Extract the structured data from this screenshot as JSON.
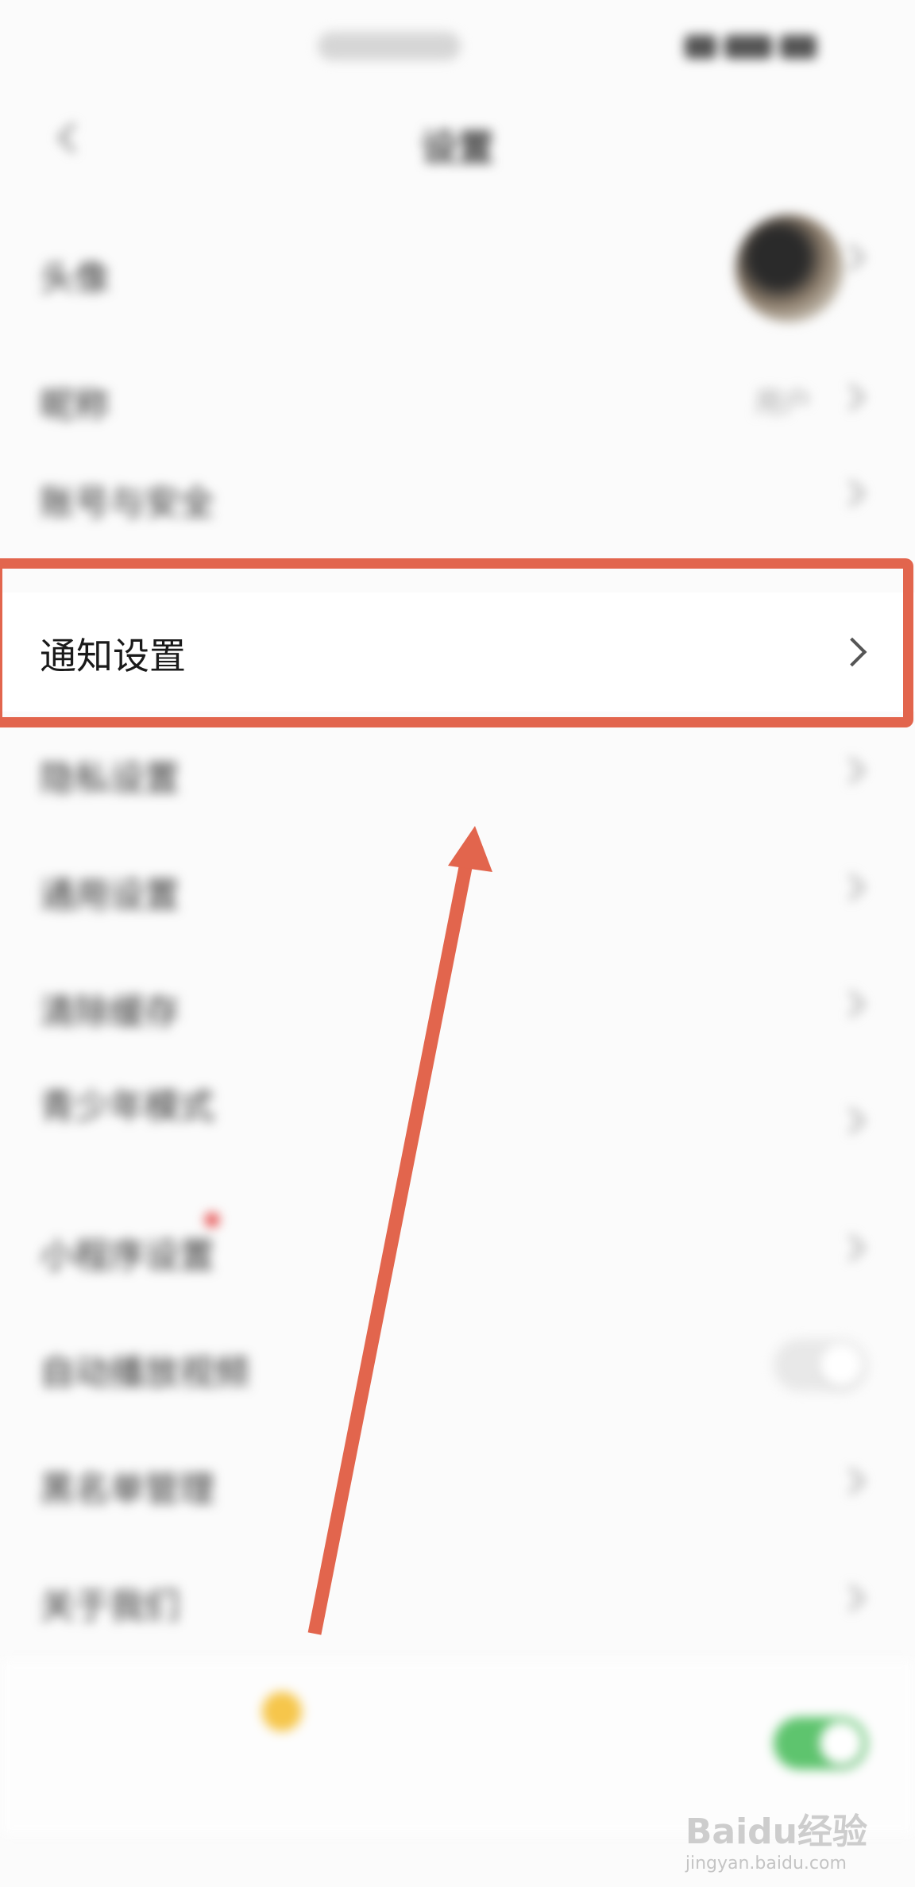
{
  "status_bar": {
    "time": "下午2:38",
    "icons": "signal wifi battery"
  },
  "nav": {
    "back_icon": "back-arrow-icon",
    "title": "设置"
  },
  "rows": [
    {
      "label": "头像",
      "value": ""
    },
    {
      "label": "昵称",
      "value": "用户"
    },
    {
      "label": "账号与安全",
      "value": ""
    },
    {
      "label": "通知设置",
      "value": ""
    },
    {
      "label": "隐私设置",
      "value": ""
    },
    {
      "label": "通用设置",
      "value": ""
    },
    {
      "label": "清除缓存",
      "value": ""
    },
    {
      "label": "青少年模式",
      "value": "",
      "sub": ""
    },
    {
      "label": "小程序设置",
      "value": ""
    },
    {
      "label": "自动播放视频",
      "value": ""
    },
    {
      "label": "黑名单管理",
      "value": ""
    },
    {
      "label": "关于我们",
      "value": ""
    }
  ],
  "bottom_card": {
    "label": "",
    "sub": ""
  },
  "annotation": {
    "highlight_color": "#e2654d",
    "arrow_color": "#e2654d"
  },
  "watermark": {
    "brand": "Baidu经验",
    "url": "jingyan.baidu.com"
  }
}
